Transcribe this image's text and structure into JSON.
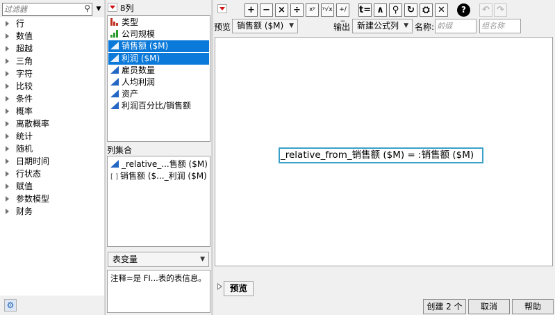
{
  "filter": {
    "placeholder": "过滤器",
    "search_icon": "search-icon",
    "menu_icon": "dropdown-icon"
  },
  "functions": [
    "行",
    "数值",
    "超越",
    "三角",
    "字符",
    "比较",
    "条件",
    "概率",
    "离散概率",
    "统计",
    "随机",
    "日期时间",
    "行状态",
    "赋值",
    "参数模型",
    "财务"
  ],
  "gear_icon": "gear-icon",
  "columns": {
    "header": "8列",
    "items": [
      {
        "label": "类型",
        "icon": "bar-chart-red-icon",
        "selected": false
      },
      {
        "label": "公司规模",
        "icon": "bar-chart-green-icon",
        "selected": false
      },
      {
        "label": "销售额 ($M)",
        "icon": "continuous-icon",
        "selected": true
      },
      {
        "label": "利润 ($M)",
        "icon": "continuous-icon",
        "selected": true
      },
      {
        "label": "雇员数量",
        "icon": "continuous-icon",
        "selected": false
      },
      {
        "label": "人均利润",
        "icon": "continuous-icon",
        "selected": false
      },
      {
        "label": "资产",
        "icon": "continuous-icon",
        "selected": false
      },
      {
        "label": "利润百分比/销售额",
        "icon": "continuous-icon",
        "selected": false
      }
    ]
  },
  "column_set": {
    "label": "列集合",
    "items": [
      {
        "label": "_relative_...售额 ($M)",
        "icon": "continuous-icon"
      },
      {
        "label": "销售额 ($..._利润 ($M)",
        "icon": "bracket-icon"
      }
    ]
  },
  "table_var": {
    "label": "表变量"
  },
  "note": "注释=是 FI...表的表信息。",
  "toolbar": {
    "buttons": [
      "+",
      "−",
      "×",
      "÷",
      "xʸ",
      "ʸ√x",
      "+/−",
      "t=",
      "∧",
      "⚲",
      "↻",
      "⛭",
      "✕"
    ],
    "help": "?",
    "undo_icon": "undo-icon",
    "redo_icon": "redo-icon"
  },
  "preview": {
    "label": "预览",
    "value": "销售额 ($M)"
  },
  "output": {
    "label": "输出",
    "value": "新建公式列"
  },
  "name": {
    "label": "名称:",
    "name_placeholder": "前缀",
    "group_placeholder": "组名称"
  },
  "formula": "_relative_from_销售额 ($M) = :销售额 ($M)",
  "preview_button": "预览",
  "buttons": {
    "create": "创建 2 个",
    "cancel": "取消",
    "help": "帮助"
  },
  "colors": {
    "selection": "#0a79d9",
    "formula_border": "#3aa0c8",
    "menu_red": "#d01010"
  }
}
